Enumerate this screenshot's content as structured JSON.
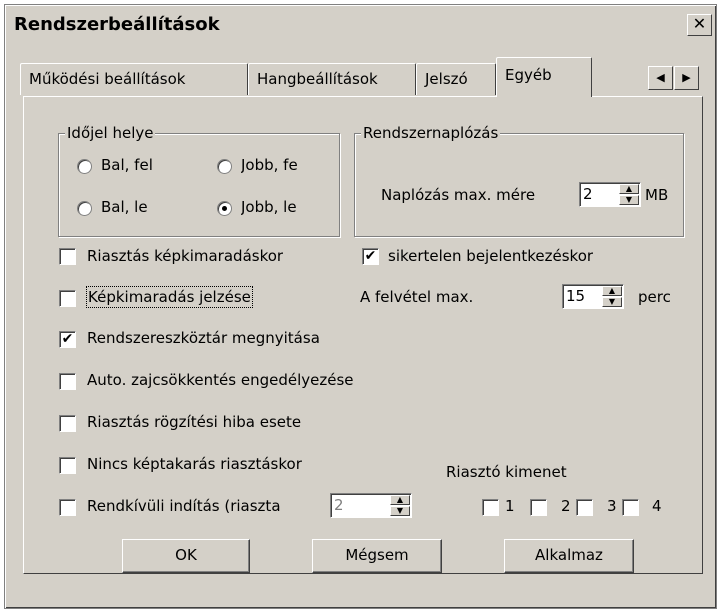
{
  "window": {
    "title": "Rendszerbeállítások",
    "close_glyph": "✕"
  },
  "tabs": [
    {
      "label": "Működési beállítások",
      "active": false
    },
    {
      "label": "Hangbeállítások",
      "active": false
    },
    {
      "label": "Jelszó",
      "active": false
    },
    {
      "label": "Egyéb",
      "active": true
    }
  ],
  "tab_scroll": {
    "left_icon": "arrow-left-icon",
    "right_icon": "arrow-right-icon",
    "left_glyph": "◀",
    "right_glyph": "▶"
  },
  "timer_group": {
    "label": "Időjel helye",
    "options": [
      {
        "label": "Bal, fel",
        "checked": false
      },
      {
        "label": "Jobb, fe",
        "checked": false
      },
      {
        "label": "Bal, le",
        "checked": false
      },
      {
        "label": "Jobb, le",
        "checked": true
      }
    ]
  },
  "log_group": {
    "label": "Rendszernaplózás",
    "size_label": "Naplózás max. mére",
    "size_value": "2",
    "size_unit": "MB"
  },
  "checks": {
    "alarm_image_loss": {
      "label": "Riasztás képkimaradáskor",
      "checked": false
    },
    "failed_login": {
      "label": "sikertelen bejelentkezéskor",
      "checked": true
    },
    "image_loss_signal": {
      "label": "Képkimaradás jelzése",
      "checked": false
    },
    "open_toolbar": {
      "label": "Rendszereszköztár megnyitása",
      "checked": true
    },
    "auto_noise": {
      "label": "Auto. zajcsökkentés engedélyezése",
      "checked": false
    },
    "alarm_record_error": {
      "label": "Riasztás rögzítési hiba esete",
      "checked": false
    },
    "no_image_cover": {
      "label": "Nincs képtakarás riasztáskor",
      "checked": false
    },
    "emergency_start": {
      "label": "Rendkívüli indítás (riaszta",
      "checked": false
    }
  },
  "recording": {
    "label": "A felvétel max.",
    "value": "15",
    "unit": "perc"
  },
  "emergency_spin": {
    "value": "2"
  },
  "alarm_output": {
    "label": "Riasztó kimenet",
    "outputs": [
      {
        "label": "1",
        "checked": false
      },
      {
        "label": "2",
        "checked": false
      },
      {
        "label": "3",
        "checked": false
      },
      {
        "label": "4",
        "checked": false
      }
    ]
  },
  "buttons": {
    "ok": "OK",
    "cancel": "Mégsem",
    "apply": "Alkalmaz"
  },
  "glyphs": {
    "check": "✔",
    "spin_up": "▲",
    "spin_down": "▼"
  }
}
